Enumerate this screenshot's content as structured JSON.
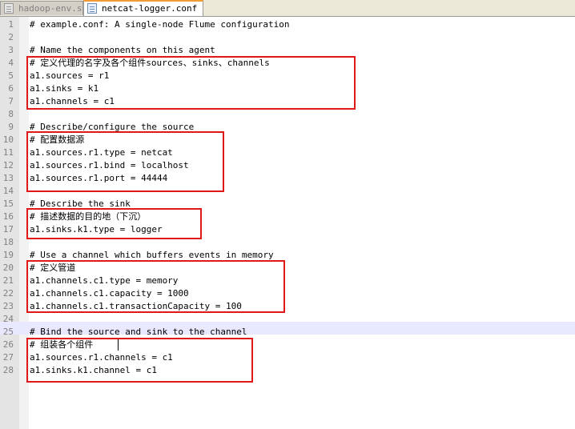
{
  "tabs": [
    {
      "label": "hadoop-env.sh"
    },
    {
      "label": "netcat-logger.conf"
    }
  ],
  "lines": [
    {
      "num": "1",
      "text": "# example.conf: A single-node Flume configuration"
    },
    {
      "num": "2",
      "text": ""
    },
    {
      "num": "3",
      "text": "# Name the components on this agent"
    },
    {
      "num": "4",
      "text": "# 定义代理的名字及各个组件sources、sinks、channels"
    },
    {
      "num": "5",
      "text": "a1.sources = r1"
    },
    {
      "num": "6",
      "text": "a1.sinks = k1"
    },
    {
      "num": "7",
      "text": "a1.channels = c1"
    },
    {
      "num": "8",
      "text": ""
    },
    {
      "num": "9",
      "text": "# Describe/configure the source"
    },
    {
      "num": "10",
      "text": "# 配置数据源"
    },
    {
      "num": "11",
      "text": "a1.sources.r1.type = netcat"
    },
    {
      "num": "12",
      "text": "a1.sources.r1.bind = localhost"
    },
    {
      "num": "13",
      "text": "a1.sources.r1.port = 44444"
    },
    {
      "num": "14",
      "text": ""
    },
    {
      "num": "15",
      "text": "# Describe the sink"
    },
    {
      "num": "16",
      "text": "# 描述数据的目的地（下沉）"
    },
    {
      "num": "17",
      "text": "a1.sinks.k1.type = logger"
    },
    {
      "num": "18",
      "text": ""
    },
    {
      "num": "19",
      "text": "# Use a channel which buffers events in memory"
    },
    {
      "num": "20",
      "text": "# 定义管道"
    },
    {
      "num": "21",
      "text": "a1.channels.c1.type = memory"
    },
    {
      "num": "22",
      "text": "a1.channels.c1.capacity = 1000"
    },
    {
      "num": "23",
      "text": "a1.channels.c1.transactionCapacity = 100"
    },
    {
      "num": "24",
      "text": ""
    },
    {
      "num": "25",
      "text": "# Bind the source and sink to the channel"
    },
    {
      "num": "26",
      "text": "# 组装各个组件"
    },
    {
      "num": "27",
      "text": "a1.sources.r1.channels = c1"
    },
    {
      "num": "28",
      "text": "a1.sinks.k1.channel = c1"
    }
  ],
  "colors": {
    "highlight_box": "#e01818",
    "active_tab_accent": "#f29b35",
    "current_line": "#e8e8ff"
  },
  "icons": {
    "tab_file": "document-icon",
    "tab_close": "close-icon"
  }
}
